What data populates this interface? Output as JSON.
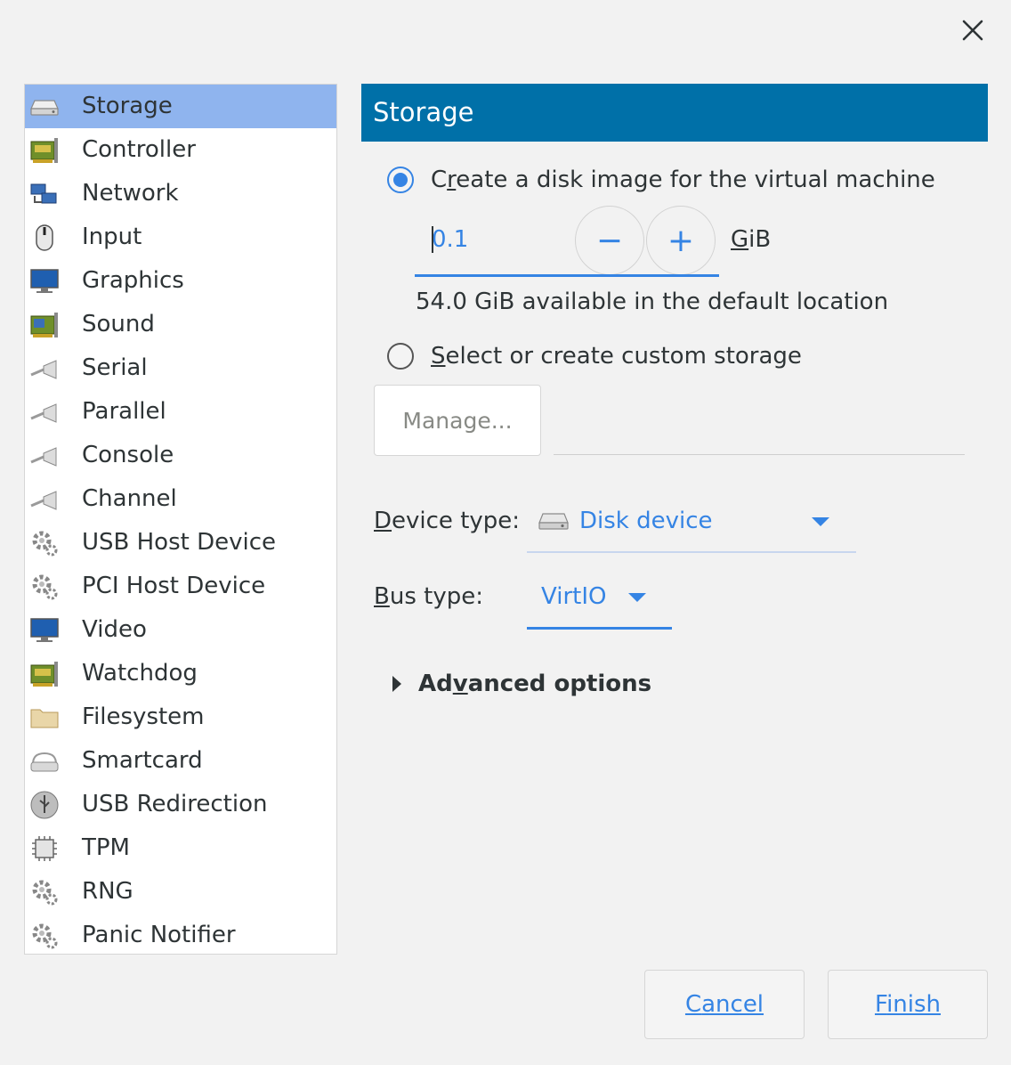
{
  "dialog": {
    "close_icon": "close-icon"
  },
  "sidebar": {
    "items": [
      {
        "label": "Storage",
        "icon": "disk-icon",
        "selected": true
      },
      {
        "label": "Controller",
        "icon": "controller-card-icon"
      },
      {
        "label": "Network",
        "icon": "network-icon"
      },
      {
        "label": "Input",
        "icon": "mouse-icon"
      },
      {
        "label": "Graphics",
        "icon": "monitor-icon"
      },
      {
        "label": "Sound",
        "icon": "sound-card-icon"
      },
      {
        "label": "Serial",
        "icon": "serial-cable-icon"
      },
      {
        "label": "Parallel",
        "icon": "parallel-cable-icon"
      },
      {
        "label": "Console",
        "icon": "console-cable-icon"
      },
      {
        "label": "Channel",
        "icon": "channel-cable-icon"
      },
      {
        "label": "USB Host Device",
        "icon": "gear-icon"
      },
      {
        "label": "PCI Host Device",
        "icon": "gear-icon"
      },
      {
        "label": "Video",
        "icon": "monitor-icon"
      },
      {
        "label": "Watchdog",
        "icon": "controller-card-icon"
      },
      {
        "label": "Filesystem",
        "icon": "folder-icon"
      },
      {
        "label": "Smartcard",
        "icon": "smartcard-icon"
      },
      {
        "label": "USB Redirection",
        "icon": "usb-icon"
      },
      {
        "label": "TPM",
        "icon": "chip-icon"
      },
      {
        "label": "RNG",
        "icon": "gear-icon"
      },
      {
        "label": "Panic Notifier",
        "icon": "gear-icon"
      }
    ]
  },
  "main": {
    "header_title": "Storage",
    "create_disk": {
      "label_pre": "C",
      "label_accel": "r",
      "label_post": "eate a disk image for the virtual machine",
      "selected": true
    },
    "size": {
      "value": "0.1",
      "unit_accel": "G",
      "unit_rest": "iB",
      "decrement": "−",
      "increment": "+"
    },
    "available_text": "54.0 GiB available in the default location",
    "custom_storage": {
      "label_accel": "S",
      "label_rest": "elect or create custom storage",
      "selected": false
    },
    "manage_button": "Manage...",
    "device_type": {
      "label_accel": "D",
      "label_rest": "evice type:",
      "value": "Disk device",
      "icon": "disk-icon"
    },
    "bus_type": {
      "label_accel": "B",
      "label_rest": "us type:",
      "value": "VirtIO"
    },
    "advanced": {
      "label_pre": "Ad",
      "label_accel": "v",
      "label_post": "anced options"
    }
  },
  "footer": {
    "cancel_accel": "C",
    "cancel_rest": "ancel",
    "finish_accel": "F",
    "finish_rest": "inish"
  }
}
